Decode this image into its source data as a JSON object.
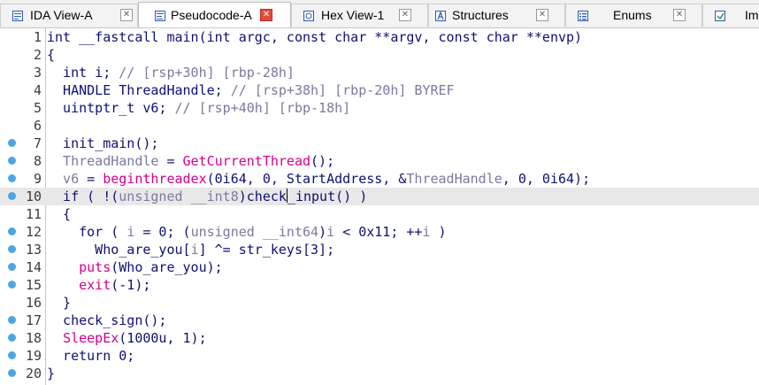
{
  "tabs": [
    {
      "label": "IDA View-A",
      "icon": "document-icon",
      "active": false
    },
    {
      "label": "Pseudocode-A",
      "icon": "pseudocode-icon",
      "active": true
    },
    {
      "label": "Hex View-1",
      "icon": "hex-icon",
      "active": false
    },
    {
      "label": "Structures",
      "icon": "structures-icon",
      "active": false
    },
    {
      "label": "Enums",
      "icon": "enums-icon",
      "active": false
    },
    {
      "label": "Im",
      "icon": "imports-icon",
      "active": false
    }
  ],
  "colors": {
    "breakpoint": "#4ba6e8",
    "imported_function": "#d0008f",
    "comment": "#7a7aa0",
    "code": "#101070",
    "current_line": "#e8e8e8",
    "active_tab_close": "#e34b3c"
  },
  "editor": {
    "current_line": 10,
    "lines": [
      {
        "n": "1",
        "bp": false
      },
      {
        "n": "2",
        "bp": false
      },
      {
        "n": "3",
        "bp": false
      },
      {
        "n": "4",
        "bp": false
      },
      {
        "n": "5",
        "bp": false
      },
      {
        "n": "6",
        "bp": false
      },
      {
        "n": "7",
        "bp": true
      },
      {
        "n": "8",
        "bp": true
      },
      {
        "n": "9",
        "bp": true
      },
      {
        "n": "10",
        "bp": true
      },
      {
        "n": "11",
        "bp": false
      },
      {
        "n": "12",
        "bp": true
      },
      {
        "n": "13",
        "bp": true
      },
      {
        "n": "14",
        "bp": true
      },
      {
        "n": "15",
        "bp": true
      },
      {
        "n": "16",
        "bp": false
      },
      {
        "n": "17",
        "bp": true
      },
      {
        "n": "18",
        "bp": true
      },
      {
        "n": "19",
        "bp": true
      },
      {
        "n": "20",
        "bp": true
      }
    ],
    "code": {
      "l1": "int __fastcall main(int argc, const char **argv, const char **envp)",
      "l2": "{",
      "l3a": "  int i; ",
      "l3b": "// [rsp+30h] [rbp-28h]",
      "l4a": "  HANDLE ThreadHandle; ",
      "l4b": "// [rsp+38h] [rbp-20h] BYREF",
      "l5a": "  uintptr_t v6; ",
      "l5b": "// [rsp+40h] [rbp-18h]",
      "l6": "",
      "l7": "  init_main();",
      "l8a": "  ThreadHandle",
      "l8b": " = ",
      "l8c": "GetCurrentThread",
      "l8d": "();",
      "l9a": "  v6",
      "l9b": " = ",
      "l9c": "beginthreadex",
      "l9d": "(0i64, 0, StartAddress, &",
      "l9e": "ThreadHandle",
      "l9f": ", 0, 0i64);",
      "l10a": "  if ( !(",
      "l10b": "unsigned __int8",
      "l10c": ")check",
      "l10d": "_input() )",
      "l11": "  {",
      "l12a": "    for ( ",
      "l12b": "i",
      "l12c": " = 0; (",
      "l12d": "unsigned __int64",
      "l12e": ")",
      "l12f": "i",
      "l12g": " < 0x11; ++",
      "l12h": "i",
      "l12i": " )",
      "l13a": "      Who_are_you[",
      "l13b": "i",
      "l13c": "] ^= str_keys[3];",
      "l14a": "    ",
      "l14b": "puts",
      "l14c": "(Who_are_you);",
      "l15a": "    ",
      "l15b": "exit",
      "l15c": "(-1);",
      "l16": "  }",
      "l17": "  check_sign();",
      "l18a": "  ",
      "l18b": "SleepEx",
      "l18c": "(1000u, 1);",
      "l19": "  return 0;",
      "l20": "}"
    }
  }
}
